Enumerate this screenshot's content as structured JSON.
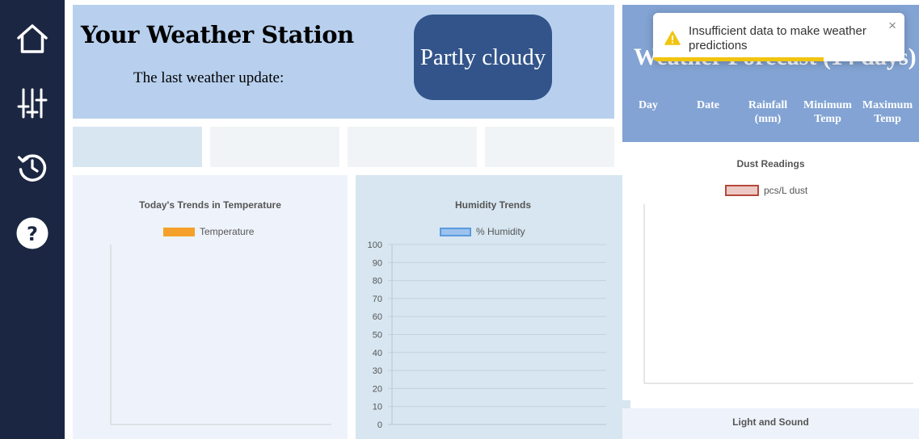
{
  "nav": {
    "items": [
      {
        "icon": "home-icon",
        "label": "Home"
      },
      {
        "icon": "sliders-icon",
        "label": "Settings"
      },
      {
        "icon": "history-icon",
        "label": "History"
      },
      {
        "icon": "help-icon",
        "label": "Help"
      }
    ]
  },
  "header": {
    "title": "Your Weather Station",
    "last_update_label": "The last weather update:",
    "condition": "Partly cloudy"
  },
  "colors": {
    "sidebar": "#1b2642",
    "header_bg": "#b8d0ee",
    "condition_bg": "#32548a",
    "forecast_bg": "#82a3d3",
    "temperature": "#f5a02a",
    "humidity": "#5c9bdf",
    "dust": "#b5483a",
    "toast_progress": "#f1c40f"
  },
  "toast": {
    "message": "Insufficient data to make weather predictions",
    "close": "×",
    "icon": "warning-icon",
    "remaining": 0.68
  },
  "forecast": {
    "title": "Weather Forecast (14 days)",
    "columns": [
      "Day",
      "Date",
      "Rainfall (mm)",
      "Minimum Temp",
      "Maximum Temp"
    ]
  },
  "chart_data": [
    {
      "type": "line",
      "title": "Today's Trends in Temperature",
      "series": [
        {
          "name": "Temperature",
          "values": []
        }
      ]
    },
    {
      "type": "line",
      "title": "Humidity Trends",
      "ylim": [
        0,
        100
      ],
      "yticks": [
        "100",
        "90",
        "80",
        "70",
        "60",
        "50",
        "40",
        "30",
        "20",
        "10",
        "0"
      ],
      "grid": true,
      "series": [
        {
          "name": "% Humidity",
          "values": []
        }
      ]
    },
    {
      "type": "line",
      "title": "Dust Readings",
      "series": [
        {
          "name": "pcs/L dust",
          "values": []
        }
      ]
    },
    {
      "type": "line",
      "title": "Light and Sound",
      "series": []
    }
  ]
}
